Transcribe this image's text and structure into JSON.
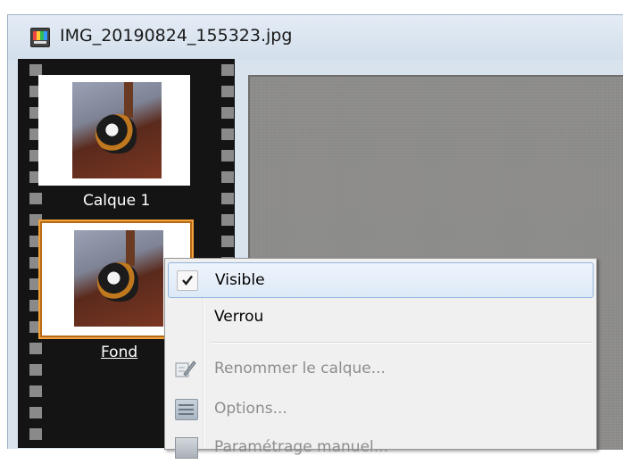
{
  "window": {
    "title": "IMG_20190824_155323.jpg",
    "icon": "image-file-icon"
  },
  "layers": [
    {
      "label": "Calque 1",
      "selected": false
    },
    {
      "label": "Fond",
      "selected": true
    }
  ],
  "context_menu": {
    "items": [
      {
        "label": "Visible",
        "checked": true,
        "enabled": true,
        "highlighted": true
      },
      {
        "label": "Verrou",
        "checked": false,
        "enabled": true
      },
      {
        "label": "Renommer le calque...",
        "enabled": false,
        "icon": "rename-icon"
      },
      {
        "label": "Options...",
        "enabled": false,
        "icon": "options-icon"
      },
      {
        "label": "Paramétrage manuel...",
        "enabled": false,
        "icon": "manual-settings-icon"
      }
    ]
  },
  "colors": {
    "film": "#141414",
    "selection_border": "#f2a23a",
    "menu_highlight_border": "#8fb4dc",
    "canvas": "#8b8a89"
  }
}
